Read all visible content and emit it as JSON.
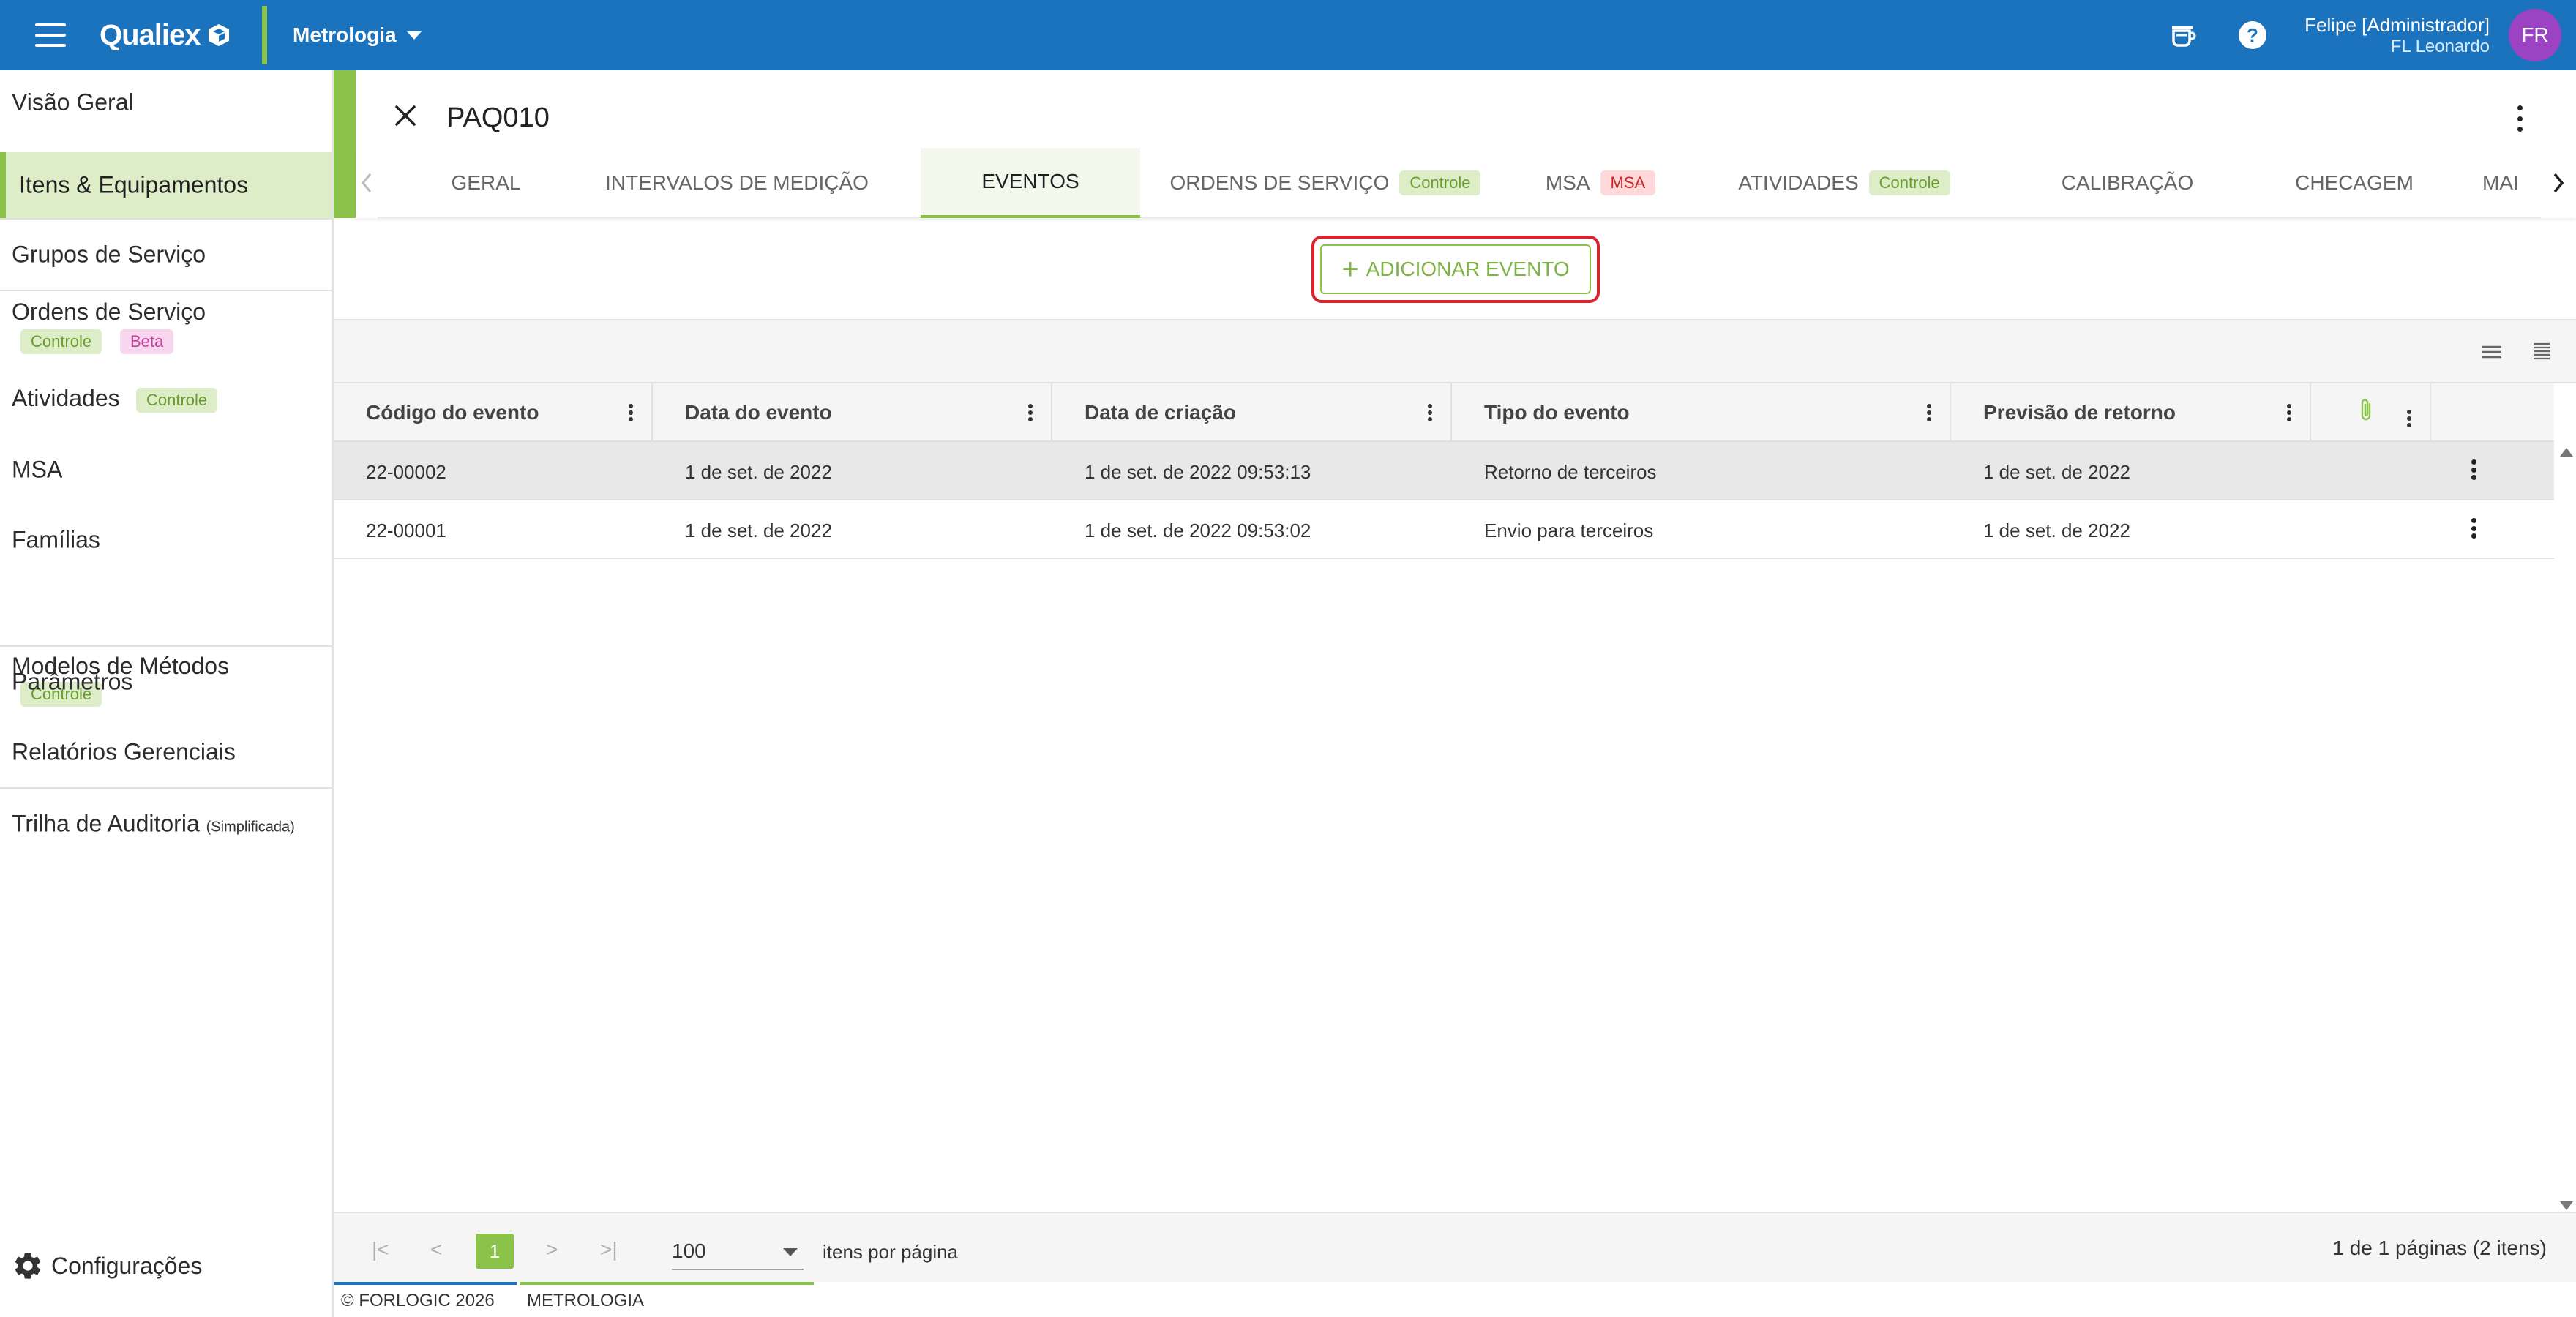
{
  "app": {
    "brand": "Qualiex",
    "module": "Metrologia",
    "user_name": "Felipe [Administrador]",
    "user_org": "FL Leonardo",
    "avatar_initials": "FR",
    "colors": {
      "primary": "#1b73bd",
      "accent": "#8bc34a",
      "highlight": "#d9232d",
      "avatar": "#9c43c4"
    }
  },
  "sidebar": {
    "items": [
      {
        "label": "Visão Geral"
      },
      {
        "label": "Itens & Equipamentos",
        "active": true
      },
      {
        "label": "Grupos de Serviço"
      },
      {
        "label": "Ordens de Serviço",
        "badges": [
          "Controle",
          "Beta"
        ]
      },
      {
        "label": "Atividades",
        "badges": [
          "Controle"
        ]
      },
      {
        "label": "MSA"
      },
      {
        "label": "Famílias"
      },
      {
        "label": "Modelos de Métodos",
        "badges": [
          "Controle"
        ]
      },
      {
        "label": "Parâmetros"
      },
      {
        "label": "Relatórios Gerenciais"
      },
      {
        "label": "Trilha de Auditoria",
        "note": "(Simplificada)"
      }
    ],
    "settings_label": "Configurações"
  },
  "detail": {
    "title": "PAQ010",
    "tabs": [
      {
        "label": "GERAL"
      },
      {
        "label": "INTERVALOS DE MEDIÇÃO"
      },
      {
        "label": "EVENTOS",
        "active": true
      },
      {
        "label": "ORDENS DE SERVIÇO",
        "badge": "Controle"
      },
      {
        "label": "MSA",
        "badge": "MSA"
      },
      {
        "label": "ATIVIDADES",
        "badge": "Controle"
      },
      {
        "label": "CALIBRAÇÃO"
      },
      {
        "label": "CHECAGEM"
      },
      {
        "label": "MAI"
      }
    ],
    "add_button": "ADICIONAR EVENTO"
  },
  "table": {
    "columns": [
      "Código do evento",
      "Data do evento",
      "Data de criação",
      "Tipo do evento",
      "Previsão de retorno"
    ],
    "rows": [
      [
        "22-00002",
        "1 de set. de 2022",
        "1 de set. de 2022 09:53:13",
        "Retorno de terceiros",
        "1 de set. de 2022"
      ],
      [
        "22-00001",
        "1 de set. de 2022",
        "1 de set. de 2022 09:53:02",
        "Envio para terceiros",
        "1 de set. de 2022"
      ]
    ]
  },
  "pager": {
    "current_page": "1",
    "page_size": "100",
    "page_size_label": "itens por página",
    "info": "1 de 1 páginas (2 itens)"
  },
  "footer": {
    "copyright": "© FORLOGIC 2026",
    "module": "METROLOGIA"
  }
}
